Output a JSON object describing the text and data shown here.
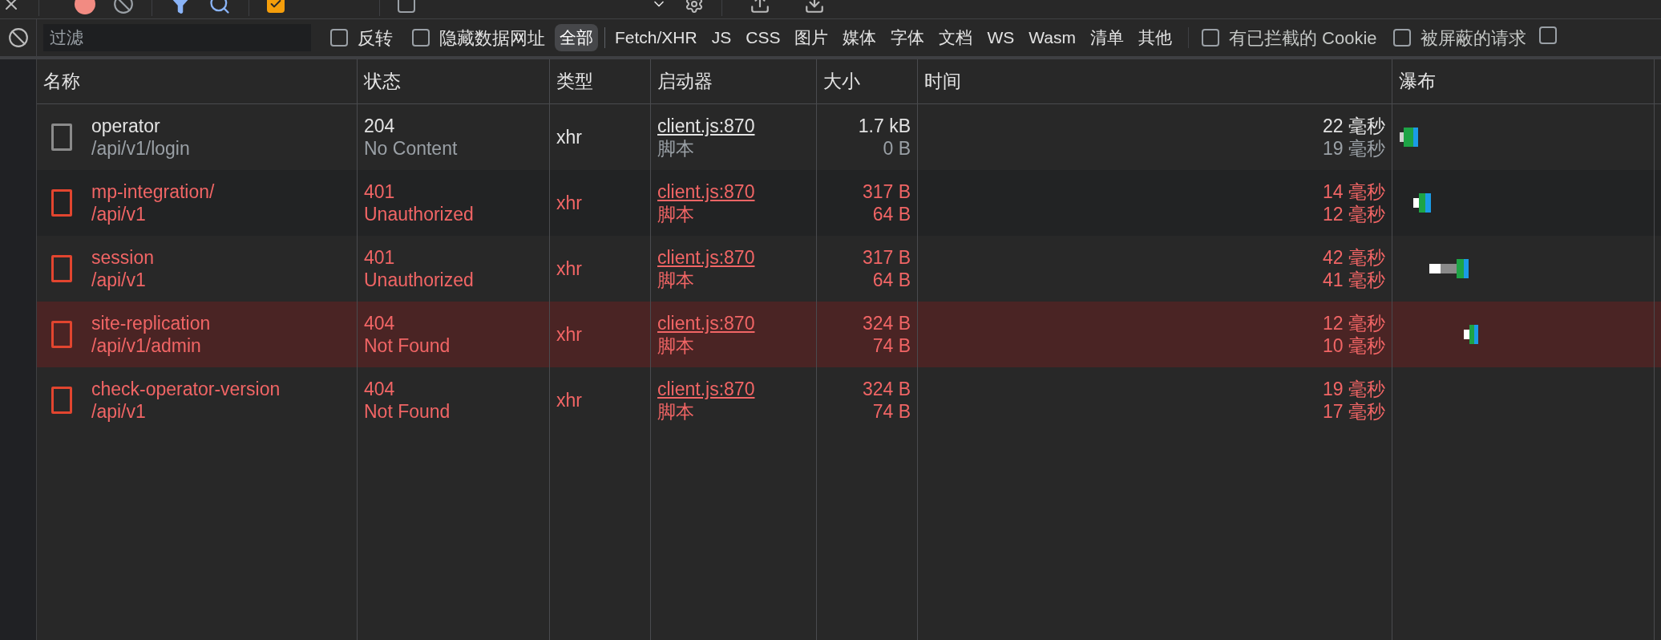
{
  "toolbar": {
    "preserve_log": {
      "checked": true
    },
    "disable_cache": {
      "checked": false
    }
  },
  "filter": {
    "placeholder": "过滤",
    "invert": {
      "label": "反转",
      "checked": false
    },
    "hide_data_urls": {
      "label": "隐藏数据网址",
      "checked": false
    },
    "types": [
      {
        "label": "全部",
        "selected": true
      },
      {
        "label": "Fetch/XHR",
        "selected": false
      },
      {
        "label": "JS",
        "selected": false
      },
      {
        "label": "CSS",
        "selected": false
      },
      {
        "label": "图片",
        "selected": false
      },
      {
        "label": "媒体",
        "selected": false
      },
      {
        "label": "字体",
        "selected": false
      },
      {
        "label": "文档",
        "selected": false
      },
      {
        "label": "WS",
        "selected": false
      },
      {
        "label": "Wasm",
        "selected": false
      },
      {
        "label": "清单",
        "selected": false
      },
      {
        "label": "其他",
        "selected": false
      }
    ],
    "blocked_cookies": {
      "label": "有已拦截的 Cookie",
      "checked": false
    },
    "blocked_requests": {
      "label": "被屏蔽的请求",
      "checked": false
    },
    "cut_checkbox": {
      "checked": false
    }
  },
  "table": {
    "columns": [
      "名称",
      "状态",
      "类型",
      "启动器",
      "大小",
      "时间",
      "瀑布"
    ],
    "rows": [
      {
        "name": "operator",
        "path": "/api/v1/login",
        "status": "204",
        "status_text": "No Content",
        "type": "xhr",
        "initiator": "client.js:870",
        "initiator_kind": "脚本",
        "size": "1.7 kB",
        "resource_size": "0 B",
        "time": "22 毫秒",
        "latency": "19 毫秒",
        "error": false,
        "selected": false
      },
      {
        "name": "mp-integration/",
        "path": "/api/v1",
        "status": "401",
        "status_text": "Unauthorized",
        "type": "xhr",
        "initiator": "client.js:870",
        "initiator_kind": "脚本",
        "size": "317 B",
        "resource_size": "64 B",
        "time": "14 毫秒",
        "latency": "12 毫秒",
        "error": true,
        "selected": false
      },
      {
        "name": "session",
        "path": "/api/v1",
        "status": "401",
        "status_text": "Unauthorized",
        "type": "xhr",
        "initiator": "client.js:870",
        "initiator_kind": "脚本",
        "size": "317 B",
        "resource_size": "64 B",
        "time": "42 毫秒",
        "latency": "41 毫秒",
        "error": true,
        "selected": false
      },
      {
        "name": "site-replication",
        "path": "/api/v1/admin",
        "status": "404",
        "status_text": "Not Found",
        "type": "xhr",
        "initiator": "client.js:870",
        "initiator_kind": "脚本",
        "size": "324 B",
        "resource_size": "74 B",
        "time": "12 毫秒",
        "latency": "10 毫秒",
        "error": true,
        "selected": true
      },
      {
        "name": "check-operator-version",
        "path": "/api/v1",
        "status": "404",
        "status_text": "Not Found",
        "type": "xhr",
        "initiator": "client.js:870",
        "initiator_kind": "脚本",
        "size": "324 B",
        "resource_size": "74 B",
        "time": "19 毫秒",
        "latency": "17 毫秒",
        "error": true,
        "selected": false
      }
    ]
  }
}
